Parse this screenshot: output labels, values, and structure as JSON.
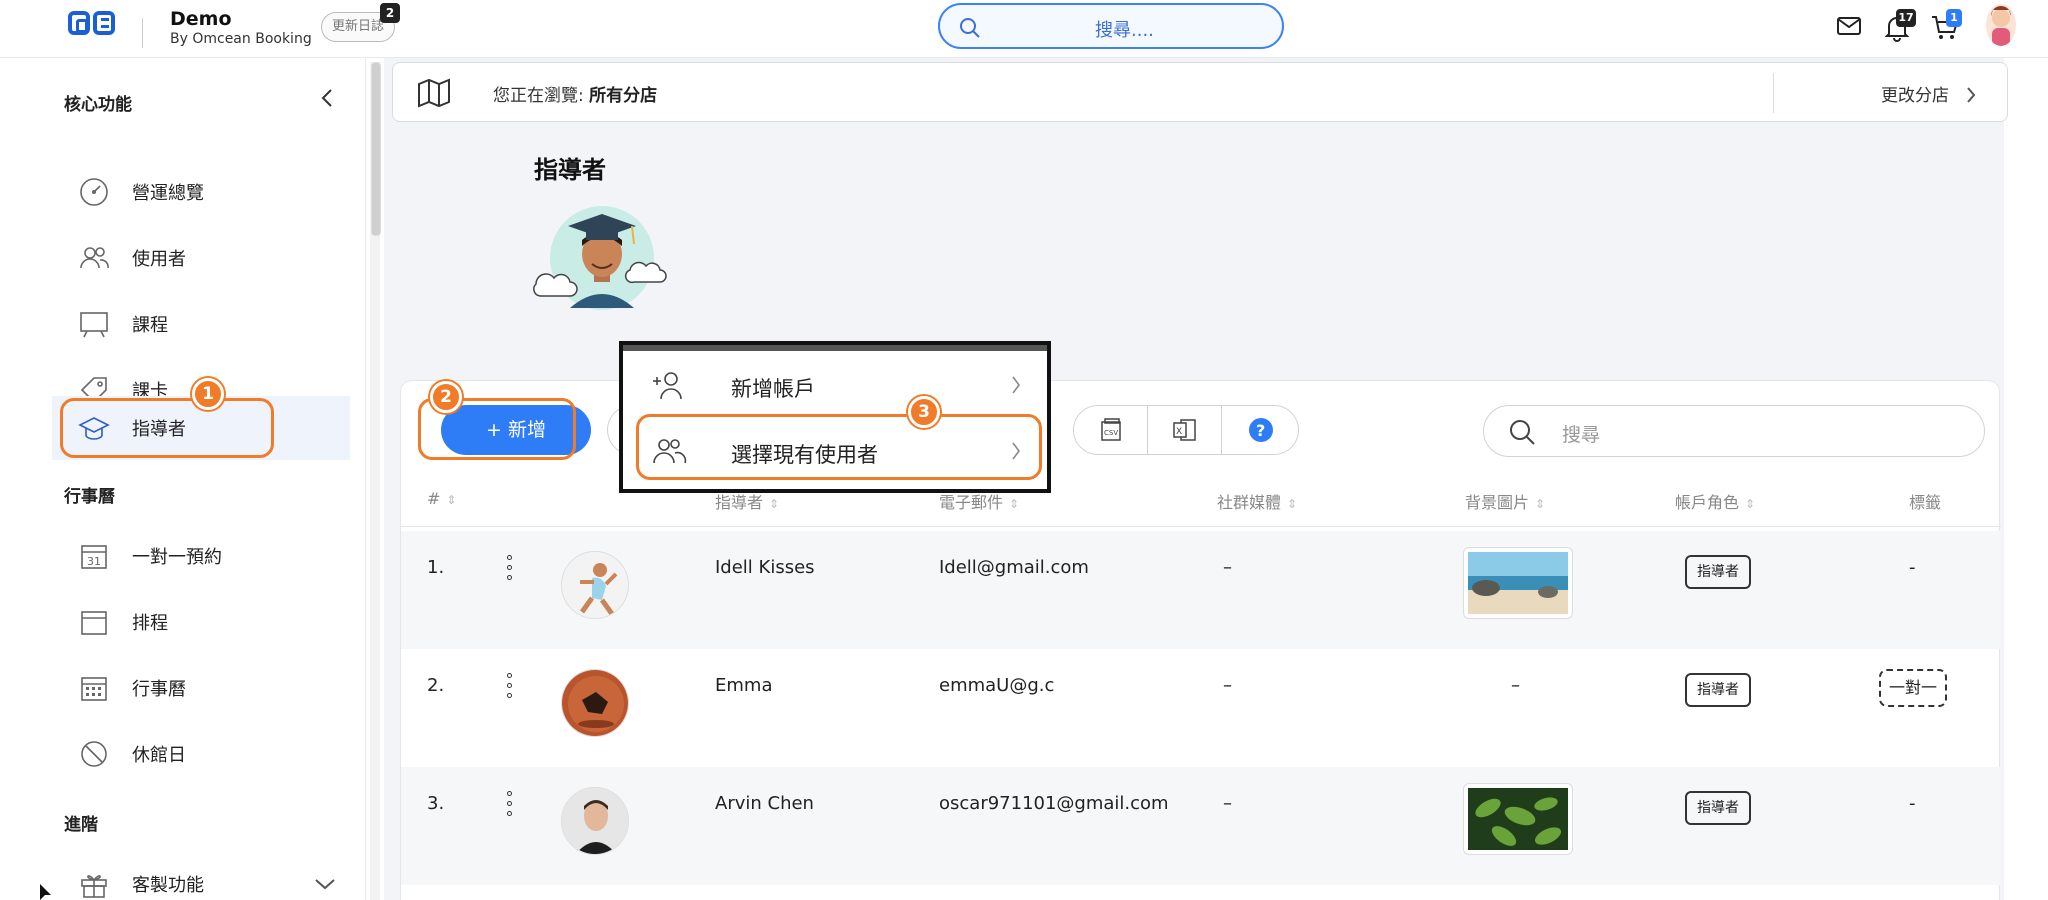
{
  "app": {
    "title": "Demo",
    "subtitle": "By Omcean Booking",
    "changelog_label": "更新日誌",
    "changelog_count": "2"
  },
  "topbar": {
    "search_placeholder": "搜尋....",
    "notif_count": "17",
    "cart_count": "1"
  },
  "sidebar": {
    "sections": [
      {
        "title": "核心功能"
      },
      {
        "title": "行事曆"
      },
      {
        "title": "進階"
      }
    ],
    "items": [
      {
        "label": "營運總覽",
        "icon": "dashboard-icon"
      },
      {
        "label": "使用者",
        "icon": "users-icon"
      },
      {
        "label": "課程",
        "icon": "easel-icon"
      },
      {
        "label": "課卡",
        "icon": "tag-icon"
      },
      {
        "label": "指導者",
        "icon": "graduation-cap-icon",
        "active": true
      },
      {
        "label": "一對一預約",
        "icon": "calendar-31-icon"
      },
      {
        "label": "排程",
        "icon": "calendar-icon"
      },
      {
        "label": "行事曆",
        "icon": "calendar-grid-icon"
      },
      {
        "label": "休館日",
        "icon": "ban-icon"
      },
      {
        "label": "客製功能",
        "icon": "gift-icon"
      }
    ]
  },
  "branch": {
    "prefix": "您正在瀏覽: ",
    "value": "所有分店",
    "change_label": "更改分店"
  },
  "page": {
    "title": "指導者"
  },
  "toolbar": {
    "add_label": "+ 新增",
    "search_placeholder": "搜尋"
  },
  "annotations": [
    "1",
    "2",
    "3"
  ],
  "dropdown": {
    "items": [
      {
        "label": "新增帳戶"
      },
      {
        "label": "選擇現有使用者"
      }
    ]
  },
  "table": {
    "columns": [
      "#",
      "指導者",
      "電子郵件",
      "社群媒體",
      "背景圖片",
      "帳戶角色",
      "標籤"
    ],
    "rows": [
      {
        "index": "1.",
        "name": "Idell Kisses",
        "email": "Idell@gmail.com",
        "social": "–",
        "bg": "",
        "role": "指導者",
        "tag": "-"
      },
      {
        "index": "2.",
        "name": "Emma",
        "email": "emmaU@g.c",
        "social": "–",
        "bg": "–",
        "role": "指導者",
        "tag": "一對一"
      },
      {
        "index": "3.",
        "name": "Arvin Chen",
        "email": "oscar971101@gmail.com",
        "social": "–",
        "bg": "",
        "role": "指導者",
        "tag": "-"
      }
    ]
  },
  "colors": {
    "accent": "#2f7df6",
    "annotation": "#f07c2a",
    "brand": "#1a5fd6"
  }
}
